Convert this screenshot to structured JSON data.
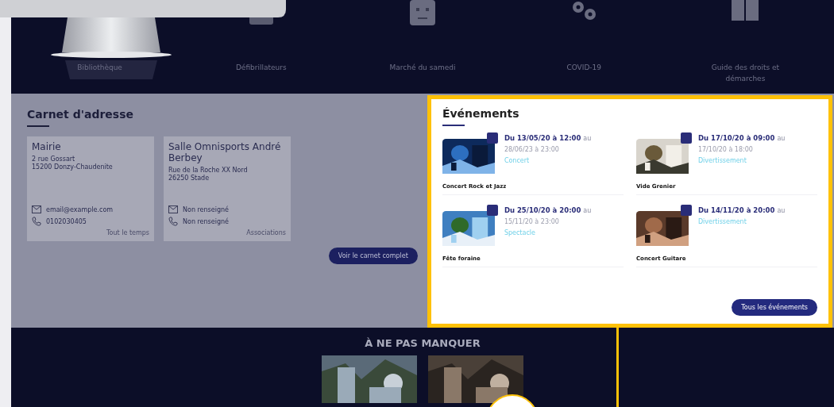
{
  "nav": {
    "items": [
      {
        "label": "Bibliothèque",
        "selected": true
      },
      {
        "label": "Défibrillateurs",
        "selected": false
      },
      {
        "label": "Marché du samedi",
        "selected": false
      },
      {
        "label": "COVID-19",
        "selected": false
      },
      {
        "label": "Guide des droits et démarches",
        "selected": false
      }
    ]
  },
  "address_book": {
    "title": "Carnet d'adresse",
    "cards": [
      {
        "name": "Mairie",
        "address": [
          "2 rue Gossart",
          "15200 Donzy-Chaudenite"
        ],
        "contacts": [
          {
            "kind": "email",
            "text": "email@example.com"
          },
          {
            "kind": "phone",
            "text": "0102030405"
          }
        ],
        "category": "Tout le temps"
      },
      {
        "name": "Salle Omnisports André Berbey",
        "address": [
          "Rue de la Roche XX Nord",
          "26250 Stade"
        ],
        "contacts": [
          {
            "kind": "email",
            "text": "Non renseigné"
          },
          {
            "kind": "phone",
            "text": "Non renseigné"
          }
        ],
        "category": "Associations"
      }
    ],
    "button": "Voir le carnet complet"
  },
  "events": {
    "title": "Événements",
    "items": [
      {
        "start": "Du 13/05/20 à 12:00",
        "suffix": "au",
        "end": "28/06/23 à 23:00",
        "category": "Concert",
        "title": "Concert Rock et Jazz"
      },
      {
        "start": "Du 17/10/20 à 09:00",
        "suffix": "au",
        "end": "17/10/20 à 18:00",
        "category": "Divertissement",
        "title": "Vide Grenier"
      },
      {
        "start": "Du 25/10/20 à 20:00",
        "suffix": "au",
        "end": "15/11/20 à 23:00",
        "category": "Spectacle",
        "title": "Fête foraine"
      },
      {
        "start": "Du 14/11/20 à 20:00",
        "suffix": "au",
        "category": "Divertissement",
        "title": "Concert Guitare"
      }
    ],
    "button": "Tous les événements"
  },
  "highlights": {
    "title": "À NE PAS MANQUER"
  }
}
